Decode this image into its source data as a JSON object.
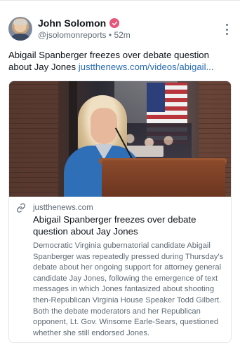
{
  "author": {
    "name": "John Solomon",
    "handle": "@jsolomonreports",
    "separator": "•",
    "time": "52m",
    "verified_color": "#e4567b"
  },
  "post": {
    "text": "Abigail Spanberger freezes over debate question about Jay Jones ",
    "link_text": "justthenews.com/videos/abigail..."
  },
  "card": {
    "domain": "justthenews.com",
    "title": "Abigail Spanberger freezes over debate question about Jay Jones",
    "description": "Democratic Virginia gubernatorial candidate Abigail Spanberger was repeatedly pressed during Thursday's debate about her ongoing support for attorney general candidate Jay Jones, following the emergence of text messages in which Jones fantasized about shooting then-Republican Virginia House Speaker Todd Gilbert. Both the debate moderators and her Republican opponent, Lt. Gov. Winsome Earle-Sears, questioned whether she still endorsed Jones."
  },
  "icons": {
    "verified": "verified-badge-icon",
    "menu": "more-vertical-icon",
    "link": "link-icon"
  },
  "colors": {
    "link": "#2b6cb0",
    "secondary_text": "#5f6b75"
  }
}
